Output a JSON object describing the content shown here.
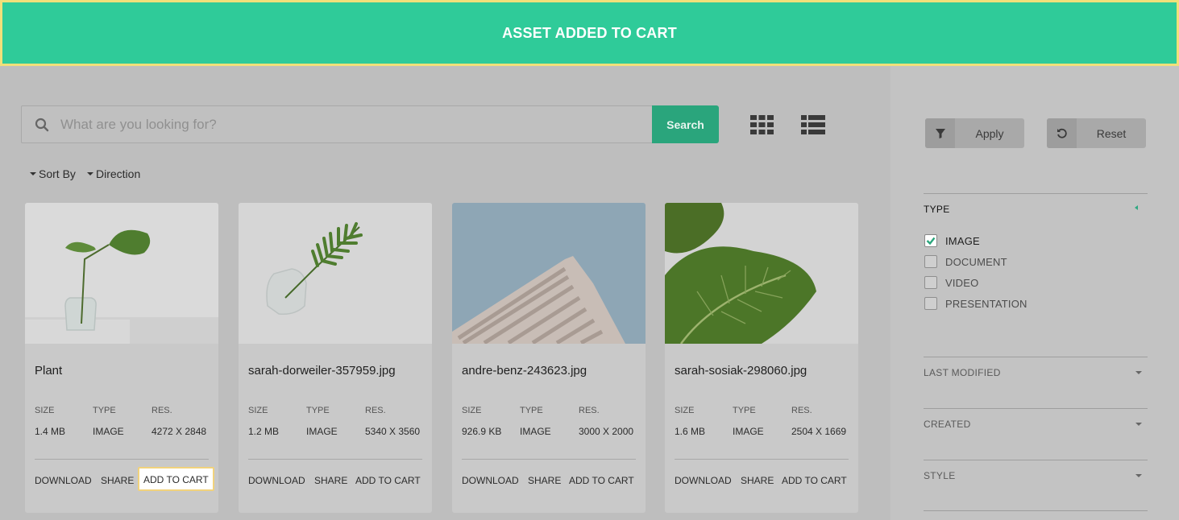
{
  "toast": {
    "message": "ASSET ADDED TO CART"
  },
  "search": {
    "placeholder": "What are you looking for?",
    "button_label": "Search"
  },
  "view_icons": [
    "grid-view-icon",
    "list-view-icon"
  ],
  "sorting": {
    "sort_by": "Sort By",
    "direction": "Direction"
  },
  "card_labels": {
    "size": "SIZE",
    "type": "TYPE",
    "res": "RES."
  },
  "assets": [
    {
      "title": "Plant",
      "size": "1.4 MB",
      "type": "IMAGE",
      "res": "4272 X 2848",
      "actions": {
        "download": "DOWNLOAD",
        "share": "SHARE",
        "add": "ADD TO CART"
      }
    },
    {
      "title": "sarah-dorweiler-357959.jpg",
      "size": "1.2 MB",
      "type": "IMAGE",
      "res": "5340 X 3560",
      "actions": {
        "download": "DOWNLOAD",
        "share": "SHARE",
        "add": "ADD TO CART"
      }
    },
    {
      "title": "andre-benz-243623.jpg",
      "size": "926.9 KB",
      "type": "IMAGE",
      "res": "3000 X 2000",
      "actions": {
        "download": "DOWNLOAD",
        "share": "SHARE",
        "add": "ADD TO CART"
      }
    },
    {
      "title": "sarah-sosiak-298060.jpg",
      "size": "1.6 MB",
      "type": "IMAGE",
      "res": "2504 X 1669",
      "actions": {
        "download": "DOWNLOAD",
        "share": "SHARE",
        "add": "ADD TO CART"
      }
    }
  ],
  "filters": {
    "apply_label": "Apply",
    "reset_label": "Reset",
    "type": {
      "title": "TYPE",
      "options": [
        {
          "label": "IMAGE",
          "checked": true
        },
        {
          "label": "DOCUMENT",
          "checked": false
        },
        {
          "label": "VIDEO",
          "checked": false
        },
        {
          "label": "PRESENTATION",
          "checked": false
        }
      ]
    },
    "last_modified": "LAST MODIFIED",
    "created": "CREATED",
    "style": "STYLE"
  },
  "colors": {
    "accent": "#2fcb99",
    "accent_dark": "#2aa57c",
    "highlight_border": "#f1d27c"
  }
}
